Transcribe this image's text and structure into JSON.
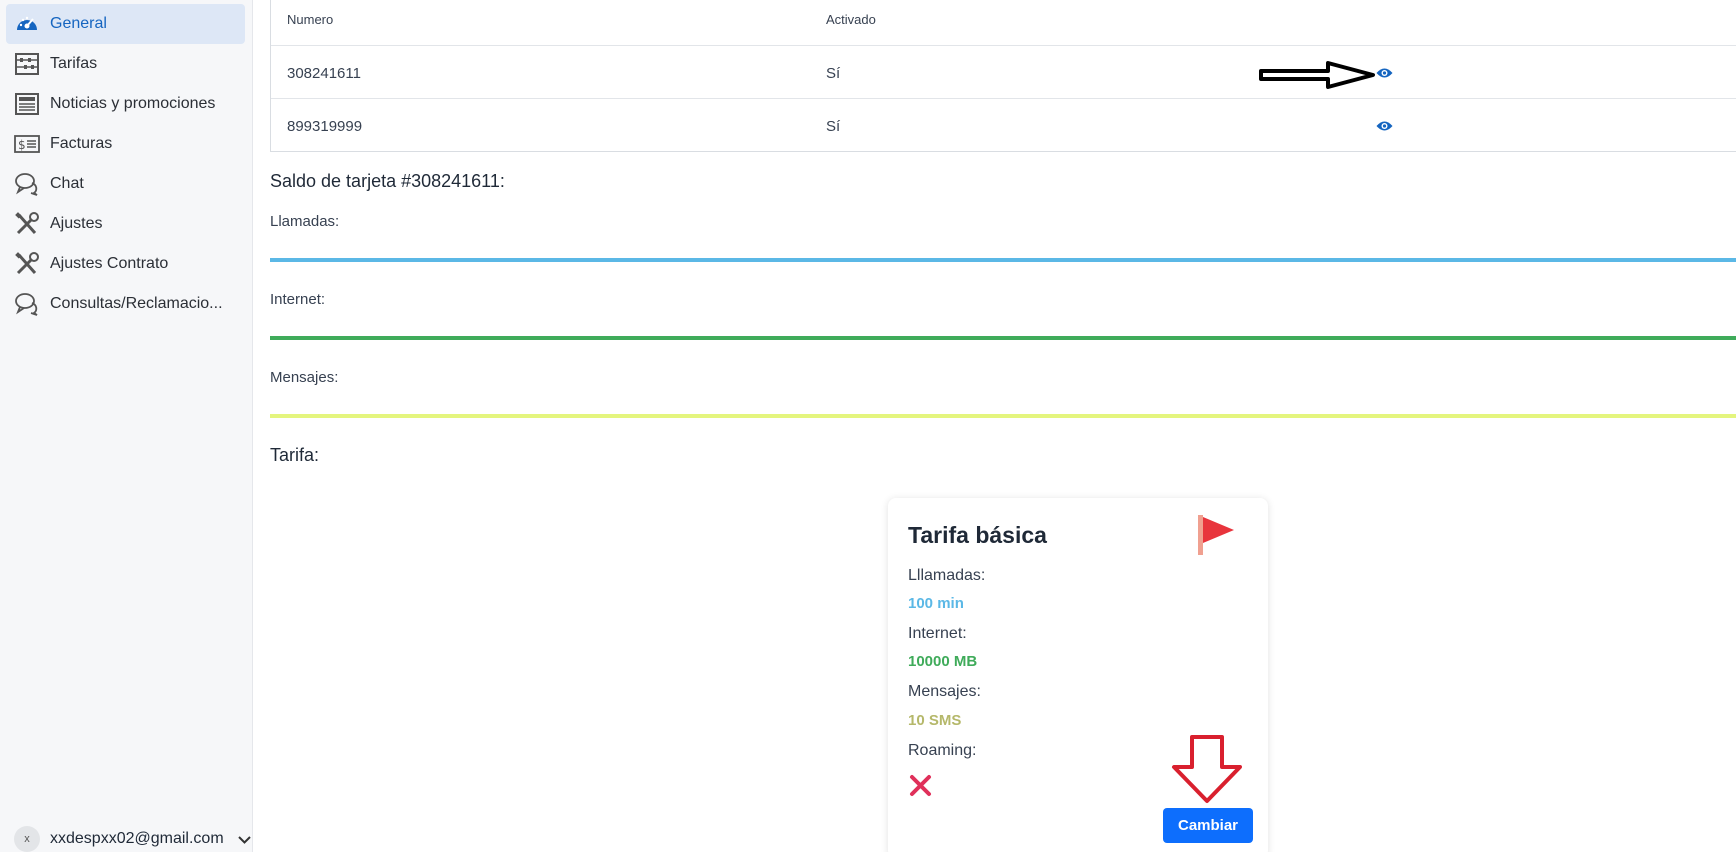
{
  "sidebar": {
    "items": [
      {
        "label": "General",
        "icon": "dashboard-gauge-icon",
        "active": true
      },
      {
        "label": "Tarifas",
        "icon": "abacus-icon",
        "active": false
      },
      {
        "label": "Noticias y promociones",
        "icon": "newspaper-icon",
        "active": false
      },
      {
        "label": "Facturas",
        "icon": "invoice-dollar-icon",
        "active": false
      },
      {
        "label": "Chat",
        "icon": "chat-bubbles-icon",
        "active": false
      },
      {
        "label": "Ajustes",
        "icon": "tools-icon",
        "active": false
      },
      {
        "label": "Ajustes Contrato",
        "icon": "tools-icon",
        "active": false
      },
      {
        "label": "Consultas/Reclamacio...",
        "icon": "chat-bubbles-icon",
        "active": false
      }
    ],
    "user": {
      "avatar": "x",
      "email": "xxdespxx02@gmail.com"
    }
  },
  "cards_table": {
    "headers": {
      "numero": "Numero",
      "activado": "Activado"
    },
    "rows": [
      {
        "numero": "308241611",
        "activado": "Sí"
      },
      {
        "numero": "899319999",
        "activado": "Sí"
      }
    ]
  },
  "balance": {
    "title": "Saldo de tarjeta #308241611:",
    "llamadas_label": "Llamadas:",
    "internet_label": "Internet:",
    "mensajes_label": "Mensajes:"
  },
  "tarifa": {
    "section_title": "Tarifa:",
    "card": {
      "name": "Tarifa básica",
      "llamadas_label": "Lllamadas:",
      "llamadas_value": "100 min",
      "internet_label": "Internet:",
      "internet_value": "10000 MB",
      "mensajes_label": "Mensajes:",
      "mensajes_value": "10 SMS",
      "roaming_label": "Roaming:",
      "roaming_enabled": false,
      "change_button": "Cambiar"
    }
  },
  "colors": {
    "accent": "#0d6efd",
    "active_nav_bg": "#dde7f6",
    "llamadas": "#5bb8e6",
    "internet": "#3fab5a",
    "mensajes": "#e4f57e",
    "mensajes_text": "#b5b86a",
    "roaming_no": "#e0305a"
  }
}
